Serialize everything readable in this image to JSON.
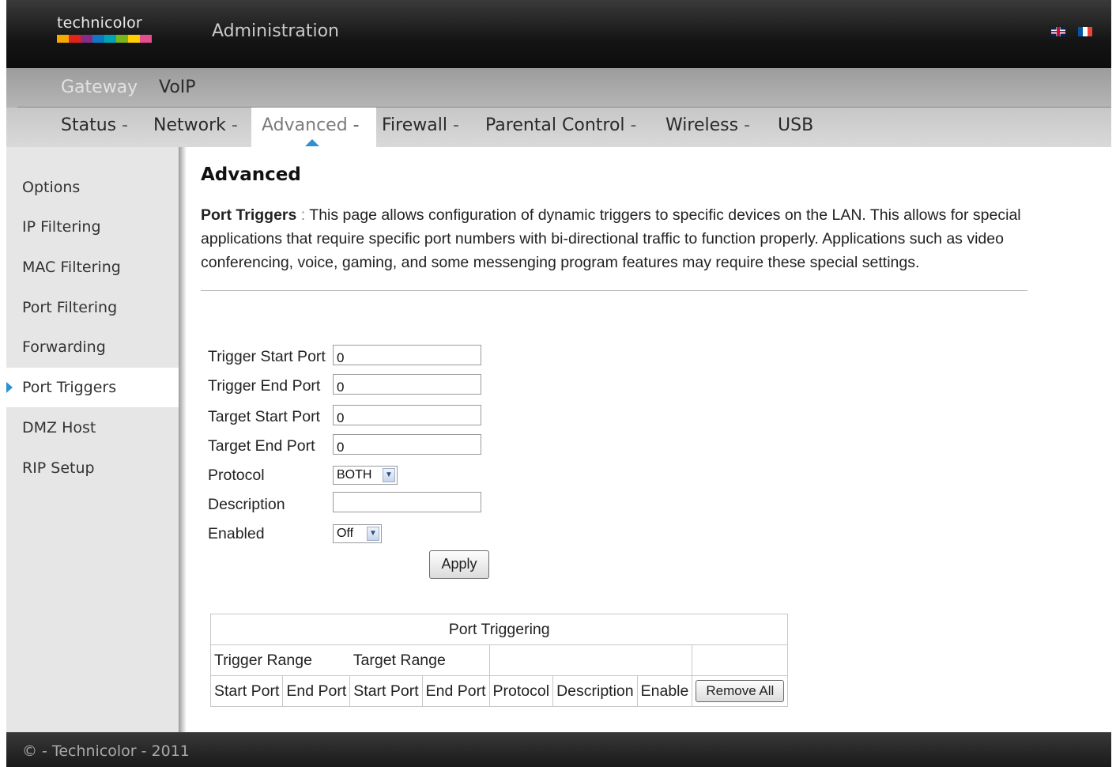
{
  "header": {
    "logo_text": "technicolor",
    "logo_colors": [
      "#f5a800",
      "#e2231a",
      "#8a2a87",
      "#0e78c5",
      "#00a4b6",
      "#7ab51d",
      "#ffcf00",
      "#e44d90"
    ],
    "title": "Administration",
    "flags": [
      "uk-flag-icon",
      "fr-flag-icon"
    ]
  },
  "top_menu": {
    "items": [
      {
        "label": "Gateway",
        "active": true,
        "color": "#e2e2e2"
      },
      {
        "label": "VoIP",
        "active": false,
        "color": "#2b2b2b"
      }
    ]
  },
  "sub_menu": {
    "items": [
      {
        "label": "Status"
      },
      {
        "label": "Network"
      },
      {
        "label": "Advanced"
      },
      {
        "label": "Firewall"
      },
      {
        "label": "Parental Control"
      },
      {
        "label": "Wireless"
      },
      {
        "label": "USB"
      }
    ],
    "separator": "-",
    "active": "Advanced",
    "accent": "#2f8fd0"
  },
  "sidebar": {
    "items": [
      {
        "label": "Options"
      },
      {
        "label": "IP Filtering"
      },
      {
        "label": "MAC Filtering"
      },
      {
        "label": "Port Filtering"
      },
      {
        "label": "Forwarding"
      },
      {
        "label": "Port Triggers"
      },
      {
        "label": "DMZ Host"
      },
      {
        "label": "RIP Setup"
      }
    ],
    "active": "Port Triggers"
  },
  "main": {
    "title": "Advanced",
    "intro_heading": "Port Triggers",
    "intro_separator": ":",
    "intro_text": "This page allows configuration of dynamic triggers to specific devices on the LAN. This allows for special applications that require specific port numbers with bi-directional traffic to function properly. Applications such as video conferencing, voice, gaming, and some messenging program features may require these special settings."
  },
  "form": {
    "trigger_start_port": {
      "label": "Trigger Start Port",
      "value": "0"
    },
    "trigger_end_port": {
      "label": "Trigger End Port",
      "value": "0"
    },
    "target_start_port": {
      "label": "Target Start Port",
      "value": "0"
    },
    "target_end_port": {
      "label": "Target End Port",
      "value": "0"
    },
    "protocol": {
      "label": "Protocol",
      "value": "BOTH"
    },
    "description": {
      "label": "Description",
      "value": ""
    },
    "enabled": {
      "label": "Enabled",
      "value": "Off"
    },
    "apply_label": "Apply"
  },
  "table": {
    "title": "Port Triggering",
    "group_headers": [
      "Trigger Range",
      "Target Range"
    ],
    "columns": [
      "Start Port",
      "End Port",
      "Start Port",
      "End Port",
      "Protocol",
      "Description",
      "Enable"
    ],
    "remove_all_label": "Remove All",
    "rows": []
  },
  "footer": {
    "text": "© - Technicolor - 2011"
  }
}
